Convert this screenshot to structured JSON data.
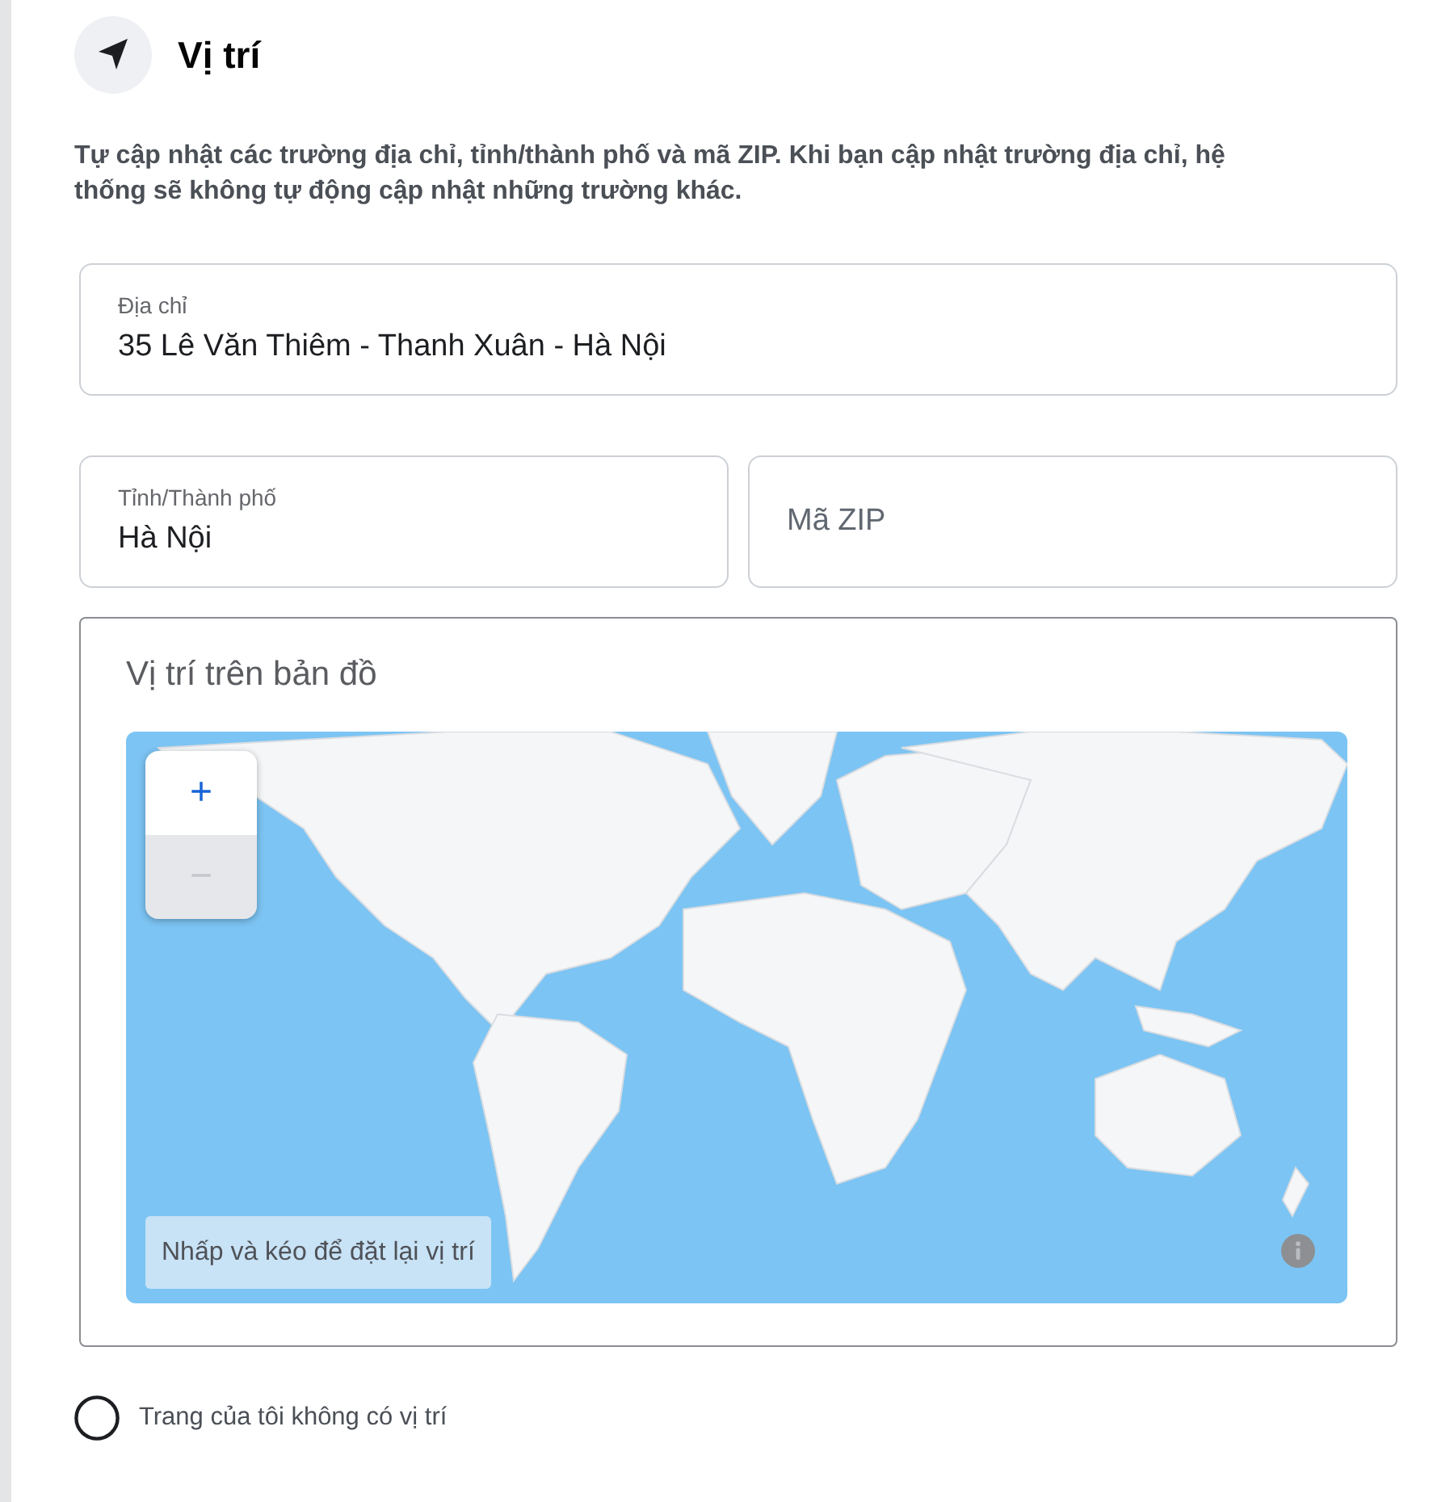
{
  "header": {
    "title": "Vị trí"
  },
  "description": "Tự cập nhật các trường địa chỉ, tỉnh/thành phố và mã ZIP. Khi bạn cập nhật trường địa chỉ, hệ thống sẽ không tự động cập nhật những trường khác.",
  "address_field": {
    "label": "Địa chỉ",
    "value": "35 Lê Văn Thiêm - Thanh Xuân - Hà Nội"
  },
  "city_field": {
    "label": "Tỉnh/Thành phố",
    "value": "Hà Nội"
  },
  "zip_field": {
    "placeholder": "Mã ZIP"
  },
  "map": {
    "title": "Vị trí trên bản đồ",
    "zoom_in": "+",
    "zoom_out": "−",
    "zoom_out_disabled": true,
    "hint": "Nhấp và kéo để đặt lại vị trí"
  },
  "no_location_option": {
    "label": "Trang của tôi không có vị trí",
    "checked": false
  }
}
